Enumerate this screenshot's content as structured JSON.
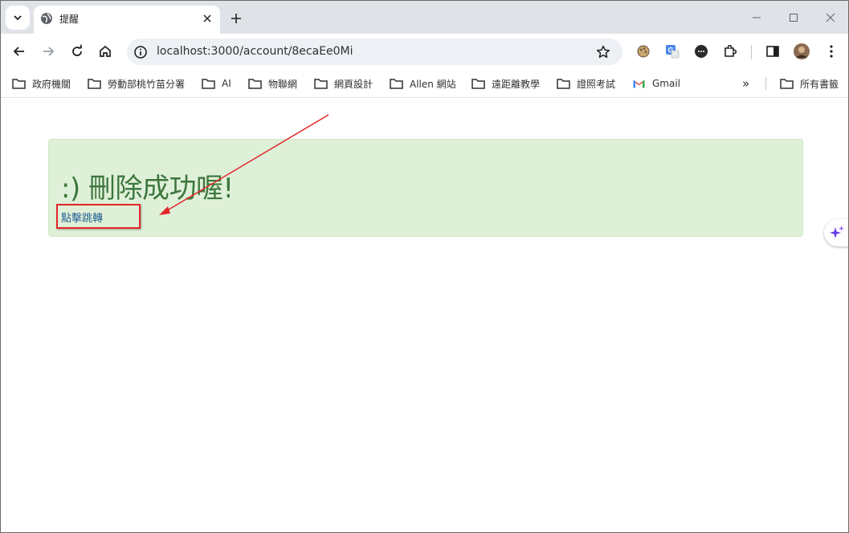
{
  "tab": {
    "title": "提醒"
  },
  "omnibox": {
    "url": "localhost:3000/account/8ecaEe0Mi"
  },
  "bookmarks": {
    "items": [
      {
        "label": "政府機關"
      },
      {
        "label": "勞動部桃竹苗分署"
      },
      {
        "label": "AI"
      },
      {
        "label": "物聯網"
      },
      {
        "label": "網頁設計"
      },
      {
        "label": "Allen 網站"
      },
      {
        "label": "遠距離教學"
      },
      {
        "label": "證照考試"
      },
      {
        "label": "Gmail"
      }
    ],
    "overflow_label": "»",
    "all_bookmarks": "所有書籤"
  },
  "page": {
    "alert_heading": ":) 刪除成功喔!",
    "redirect_link": "點擊跳轉"
  },
  "colors": {
    "alert_bg": "#dff0d8",
    "alert_text": "#3c763d",
    "link": "#2a6496",
    "annotation": "#e3262a"
  },
  "icons": {
    "tab_search": "chevron-down-icon",
    "favicon": "globe-icon",
    "back": "arrow-left-icon",
    "forward": "arrow-right-icon",
    "reload": "reload-icon",
    "home": "home-icon",
    "site_info": "info-icon",
    "bookmark_star": "star-icon"
  }
}
